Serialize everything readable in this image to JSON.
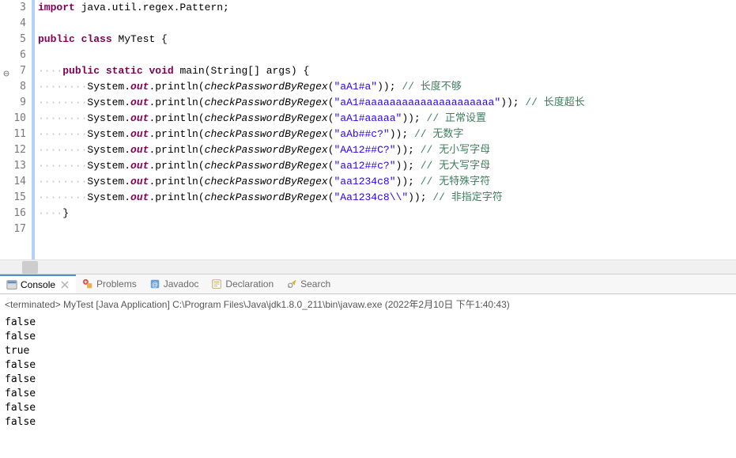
{
  "editor": {
    "lines": [
      {
        "num": 3,
        "fold": false
      },
      {
        "num": 4,
        "fold": false
      },
      {
        "num": 5,
        "fold": false
      },
      {
        "num": 6,
        "fold": false
      },
      {
        "num": 7,
        "fold": true,
        "foldLabel": "⊖"
      },
      {
        "num": 8,
        "fold": false
      },
      {
        "num": 9,
        "fold": false
      },
      {
        "num": 10,
        "fold": false
      },
      {
        "num": 11,
        "fold": false
      },
      {
        "num": 12,
        "fold": false
      },
      {
        "num": 13,
        "fold": false
      },
      {
        "num": 14,
        "fold": false
      },
      {
        "num": 15,
        "fold": false
      },
      {
        "num": 16,
        "fold": false
      },
      {
        "num": 17,
        "fold": false
      }
    ],
    "code": {
      "l3": {
        "kw1": "import",
        "rest": " java.util.regex.Pattern;"
      },
      "l5": {
        "kw1": "public",
        "kw2": "class",
        "cls": " MyTest {"
      },
      "l7": {
        "ws": "····",
        "kw1": "public",
        "kw2": "static",
        "kw3": "void",
        "sig": " main(String[] args) {"
      },
      "l8": {
        "ws": "········",
        "pre": "System.",
        "out": "out",
        "mid": ".println(",
        "fn": "checkPasswordByRegex",
        "op": "(",
        "str": "\"aA1#a\"",
        "cp": ")); ",
        "cmt": "// 长度不够"
      },
      "l9": {
        "ws": "········",
        "pre": "System.",
        "out": "out",
        "mid": ".println(",
        "fn": "checkPasswordByRegex",
        "op": "(",
        "str": "\"aA1#aaaaaaaaaaaaaaaaaaaaa\"",
        "cp": ")); ",
        "cmt": "// 长度超长"
      },
      "l10": {
        "ws": "········",
        "pre": "System.",
        "out": "out",
        "mid": ".println(",
        "fn": "checkPasswordByRegex",
        "op": "(",
        "str": "\"aA1#aaaaa\"",
        "cp": ")); ",
        "cmt": "// 正常设置"
      },
      "l11": {
        "ws": "········",
        "pre": "System.",
        "out": "out",
        "mid": ".println(",
        "fn": "checkPasswordByRegex",
        "op": "(",
        "str": "\"aAb##c?\"",
        "cp": ")); ",
        "cmt": "// 无数字"
      },
      "l12": {
        "ws": "········",
        "pre": "System.",
        "out": "out",
        "mid": ".println(",
        "fn": "checkPasswordByRegex",
        "op": "(",
        "str": "\"AA12##C?\"",
        "cp": ")); ",
        "cmt": "// 无小写字母"
      },
      "l13": {
        "ws": "········",
        "pre": "System.",
        "out": "out",
        "mid": ".println(",
        "fn": "checkPasswordByRegex",
        "op": "(",
        "str": "\"aa12##c?\"",
        "cp": ")); ",
        "cmt": "// 无大写字母"
      },
      "l14": {
        "ws": "········",
        "pre": "System.",
        "out": "out",
        "mid": ".println(",
        "fn": "checkPasswordByRegex",
        "op": "(",
        "str": "\"aa1234c8\"",
        "cp": ")); ",
        "cmt": "// 无特殊字符"
      },
      "l15": {
        "ws": "········",
        "pre": "System.",
        "out": "out",
        "mid": ".println(",
        "fn": "checkPasswordByRegex",
        "op": "(",
        "str": "\"Aa1234c8\\\\\"",
        "cp": ")); ",
        "cmt": "// 非指定字符"
      },
      "l16": {
        "ws": "····",
        "txt": "}"
      }
    }
  },
  "tabs": {
    "console": "Console",
    "problems": "Problems",
    "javadoc": "Javadoc",
    "declaration": "Declaration",
    "search": "Search"
  },
  "console": {
    "termPrefix": "<terminated>",
    "termInfo": " MyTest [Java Application] C:\\Program Files\\Java\\jdk1.8.0_211\\bin\\javaw.exe (2022年2月10日 下午1:40:43)",
    "output": [
      "false",
      "false",
      "true",
      "false",
      "false",
      "false",
      "false",
      "false"
    ]
  }
}
